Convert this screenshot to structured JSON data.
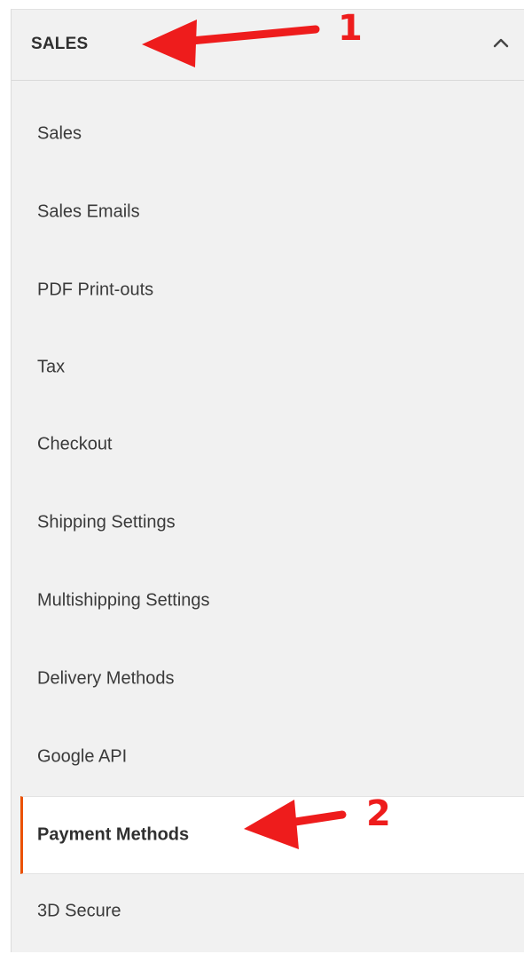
{
  "section": {
    "title": "SALES",
    "expanded": true
  },
  "items": [
    {
      "label": "Sales"
    },
    {
      "label": "Sales Emails"
    },
    {
      "label": "PDF Print-outs"
    },
    {
      "label": "Tax"
    },
    {
      "label": "Checkout"
    },
    {
      "label": "Shipping Settings"
    },
    {
      "label": "Multishipping Settings"
    },
    {
      "label": "Delivery Methods"
    },
    {
      "label": "Google API"
    },
    {
      "label": "Payment Methods"
    },
    {
      "label": "3D Secure"
    }
  ],
  "active_item": "Payment Methods",
  "annotations": {
    "step1": "1",
    "step2": "2"
  },
  "colors": {
    "panel_bg": "#f1f1f1",
    "active_bg": "#ffffff",
    "active_accent": "#eb5202",
    "annotation": "#ee1c1c"
  },
  "icons": {
    "collapse": "chevron-up-icon"
  }
}
